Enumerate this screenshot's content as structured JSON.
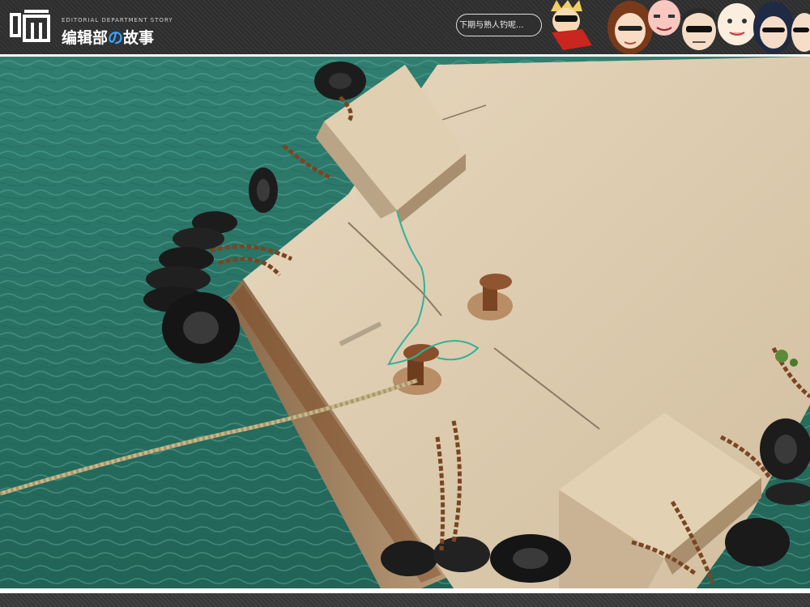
{
  "header": {
    "logo_subtitle": "EDITORIAL DEPARTMENT STORY",
    "logo_title_part1": "编辑部",
    "logo_title_o": "の",
    "logo_title_part2": "故事",
    "speech_bubble": "下期与熟人钓呢...",
    "background_color": "#2f2f2f",
    "accent_color": "#3aa2ff"
  },
  "photo": {
    "subject": "concrete pier with tire fenders, rusty chains, bollards and mooring rope over green sea water",
    "colors": {
      "water": "#2f7f70",
      "concrete": "#d9c8ad",
      "tire": "#1c1c1c",
      "rust": "#7a4522",
      "rope": "#c8b78a",
      "green_line": "#2fb39a"
    }
  }
}
